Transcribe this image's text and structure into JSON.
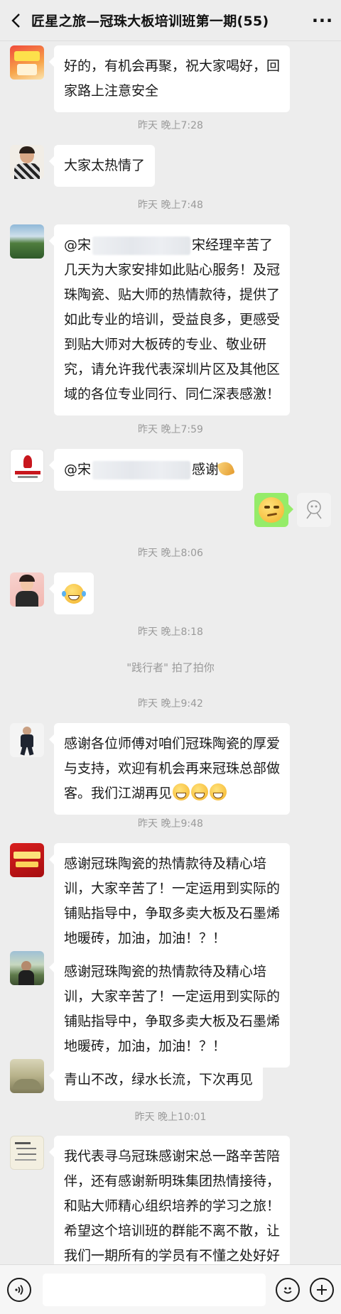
{
  "header": {
    "back_icon": "chevron-left-icon",
    "title": "匠星之旅—冠珠大板培训班第一期(55)",
    "more_icon": "more-dots-icon"
  },
  "messages": [
    {
      "type": "text",
      "avatar": "avatar-promo",
      "text": "好的，有机会再聚，祝大家喝好，回家路上注意安全"
    },
    {
      "type": "time",
      "text": "昨天 晚上7:28"
    },
    {
      "type": "text",
      "avatar": "avatar-woman",
      "text": "大家太热情了"
    },
    {
      "type": "time",
      "text": "昨天 晚上7:48"
    },
    {
      "type": "text",
      "avatar": "avatar-landscape",
      "prefix": "@宋",
      "text": "宋经理辛苦了几天为大家安排如此贴心服务！及冠珠陶瓷、贴大师的热情款待，提供了如此专业的培训，受益良多，更感受到贴大师对大板砖的专业、敬业研究，请允许我代表深圳片区及其他区域的各位专业同行、同仁深表感激！"
    },
    {
      "type": "time",
      "text": "昨天 晚上7:59"
    },
    {
      "type": "text",
      "avatar": "avatar-guanzhu-logo",
      "prefix": "@宋",
      "text": "感谢"
    },
    {
      "type": "self-emoji",
      "avatar": "avatar-self"
    },
    {
      "type": "time",
      "text": "昨天 晚上8:06"
    },
    {
      "type": "emoji",
      "avatar": "avatar-girl"
    },
    {
      "type": "time",
      "text": "昨天 晚上8:18"
    },
    {
      "type": "system",
      "text": "\"践行者\" 拍了拍你"
    },
    {
      "type": "time",
      "text": "昨天 晚上9:42"
    },
    {
      "type": "text",
      "avatar": "avatar-man-standing",
      "text": "感谢各位师傅对咱们冠珠陶瓷的厚爱与支持，欢迎有机会再来冠珠总部做客。我们江湖再见"
    },
    {
      "type": "time",
      "text": "昨天 晚上9:48"
    },
    {
      "type": "text",
      "avatar": "avatar-red-banner",
      "text": "感谢冠珠陶瓷的热情款待及精心培训，大家辛苦了！一定运用到实际的铺贴指导中，争取多卖大板及石墨烯地暖砖，加油，加油！？！"
    },
    {
      "type": "text",
      "avatar": "avatar-man-outdoor",
      "text": "感谢冠珠陶瓷的热情款待及精心培训，大家辛苦了！一定运用到实际的铺贴指导中，争取多卖大板及石墨烯地暖砖，加油，加油！？！"
    },
    {
      "type": "text",
      "avatar": "avatar-mountain",
      "text": "青山不改，绿水长流，下次再见"
    },
    {
      "type": "time",
      "text": "昨天 晚上10:01"
    },
    {
      "type": "text",
      "avatar": "avatar-calligraphy",
      "text": "我代表寻乌冠珠感谢宋总一路辛苦陪伴，还有感谢新明珠集团热情接待，和贴大师精心组织培养的学习之旅！希望这个培训班的群能不离不散，让我们一期所有的学员有不懂之处好好交流"
    }
  ],
  "footer": {
    "voice_icon": "voice-icon",
    "emoji_icon": "emoji-icon",
    "plus_icon": "plus-icon"
  }
}
